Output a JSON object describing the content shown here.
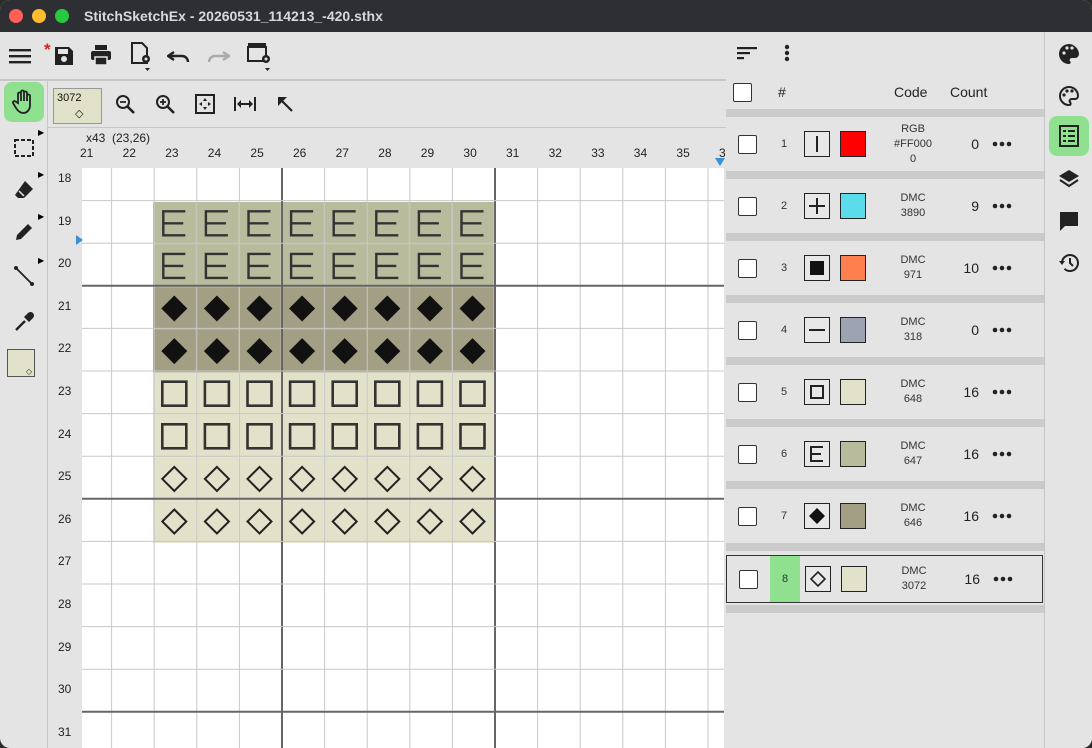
{
  "window": {
    "title": "StitchSketchEx - 20260531_114213_-420.sthx"
  },
  "toolbar": {
    "unsaved_marker": "*"
  },
  "zoom_box": {
    "number": "3072",
    "symbol": "◇"
  },
  "cursor_info": "x43  (23,26)",
  "ruler": {
    "columns": [
      "21",
      "22",
      "23",
      "24",
      "25",
      "26",
      "27",
      "28",
      "29",
      "30",
      "31",
      "32",
      "33",
      "34",
      "35",
      "3"
    ],
    "rows": [
      "18",
      "19",
      "20",
      "21",
      "22",
      "23",
      "24",
      "25",
      "26",
      "27",
      "28",
      "29",
      "30",
      "31"
    ]
  },
  "grid_rows": [
    {
      "symbol": "E",
      "color": "#b8bb9c"
    },
    {
      "symbol": "E",
      "color": "#b8bb9c"
    },
    {
      "symbol": "diamond-filled",
      "color": "#a39f85"
    },
    {
      "symbol": "diamond-filled",
      "color": "#a39f85"
    },
    {
      "symbol": "square",
      "color": "#e2e1c9"
    },
    {
      "symbol": "square",
      "color": "#e2e1c9"
    },
    {
      "symbol": "diamond-outline",
      "color": "#e2e1c9"
    },
    {
      "symbol": "diamond-outline",
      "color": "#e2e1c9"
    }
  ],
  "palette": {
    "headers": {
      "number": "#",
      "code": "Code",
      "count": "Count"
    },
    "rows": [
      {
        "num": "1",
        "symbol": "vbar",
        "swatch": "#ff0000",
        "code1": "RGB",
        "code2": "#FF000",
        "code3": "0",
        "count": "0",
        "selected": false
      },
      {
        "num": "2",
        "symbol": "plus",
        "swatch": "#5bdcea",
        "code1": "DMC",
        "code2": "3890",
        "code3": "",
        "count": "9",
        "selected": false
      },
      {
        "num": "3",
        "symbol": "square-filled",
        "swatch": "#ff7f4f",
        "code1": "DMC",
        "code2": "971",
        "code3": "",
        "count": "10",
        "selected": false
      },
      {
        "num": "4",
        "symbol": "minus",
        "swatch": "#9ea3b3",
        "code1": "DMC",
        "code2": "318",
        "code3": "",
        "count": "0",
        "selected": false
      },
      {
        "num": "5",
        "symbol": "square",
        "swatch": "#e2e1c9",
        "code1": "DMC",
        "code2": "648",
        "code3": "",
        "count": "16",
        "selected": false
      },
      {
        "num": "6",
        "symbol": "E",
        "swatch": "#b8bb9c",
        "code1": "DMC",
        "code2": "647",
        "code3": "",
        "count": "16",
        "selected": false
      },
      {
        "num": "7",
        "symbol": "diamond-filled",
        "swatch": "#a39f85",
        "code1": "DMC",
        "code2": "646",
        "code3": "",
        "count": "16",
        "selected": false
      },
      {
        "num": "8",
        "symbol": "diamond-outline",
        "swatch": "#e2e1c9",
        "code1": "DMC",
        "code2": "3072",
        "code3": "",
        "count": "16",
        "selected": true
      }
    ]
  },
  "colors": {
    "selected_green": "#8fe08f",
    "titlebar": "#2e2f33"
  }
}
